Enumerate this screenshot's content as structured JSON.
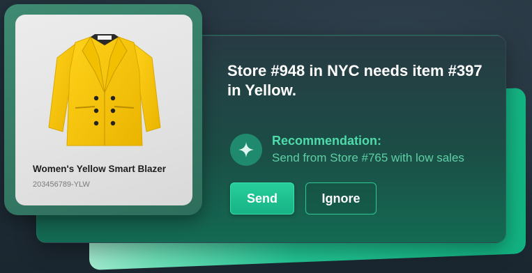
{
  "notification": {
    "headline": "Store #948 in NYC needs item #397 in Yellow.",
    "recommendation_title": "Recommendation:",
    "recommendation_text": "Send from Store #765 with low sales",
    "recommendation_icon": "sparkle-icon",
    "send_label": "Send",
    "ignore_label": "Ignore"
  },
  "product": {
    "name": "Women's Yellow Smart Blazer",
    "sku": "203456789-YLW",
    "image": "yellow-blazer-image"
  },
  "colors": {
    "accent": "#22c493",
    "recommendation_text": "#5fd0a6",
    "product_color": "#f5c400"
  }
}
